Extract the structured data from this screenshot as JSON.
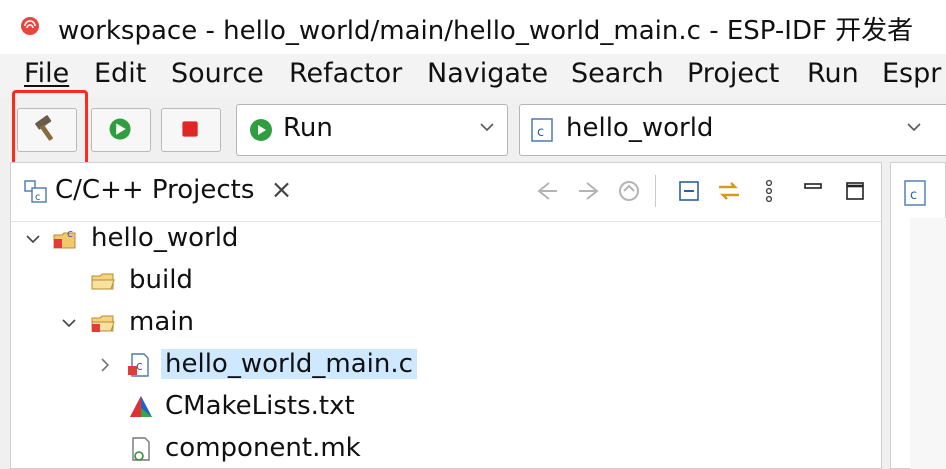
{
  "window": {
    "title": "workspace - hello_world/main/hello_world_main.c - ESP-IDF 开发者"
  },
  "menu": [
    "File",
    "Edit",
    "Source",
    "Refactor",
    "Navigate",
    "Search",
    "Project",
    "Run",
    "Espr"
  ],
  "toolbar": {
    "build_icon": "hammer-icon",
    "run_icon": "green-play-icon",
    "stop_icon": "red-stop-icon",
    "launch_mode": "Run",
    "launch_target": "hello_world",
    "highlight_color": "#ff2a1f"
  },
  "projects_view": {
    "tab_label": "C/C++ Projects",
    "close_glyph": "×",
    "tree": [
      {
        "label": "hello_world",
        "icon": "c-project-icon",
        "expanded": true
      },
      {
        "label": "build",
        "icon": "folder-icon"
      },
      {
        "label": "main",
        "icon": "source-folder-icon",
        "expanded": true
      },
      {
        "label": "hello_world_main.c",
        "icon": "c-file-icon",
        "selected": true
      },
      {
        "label": "CMakeLists.txt",
        "icon": "cmake-icon"
      },
      {
        "label": "component.mk",
        "icon": "makefile-icon"
      }
    ]
  }
}
